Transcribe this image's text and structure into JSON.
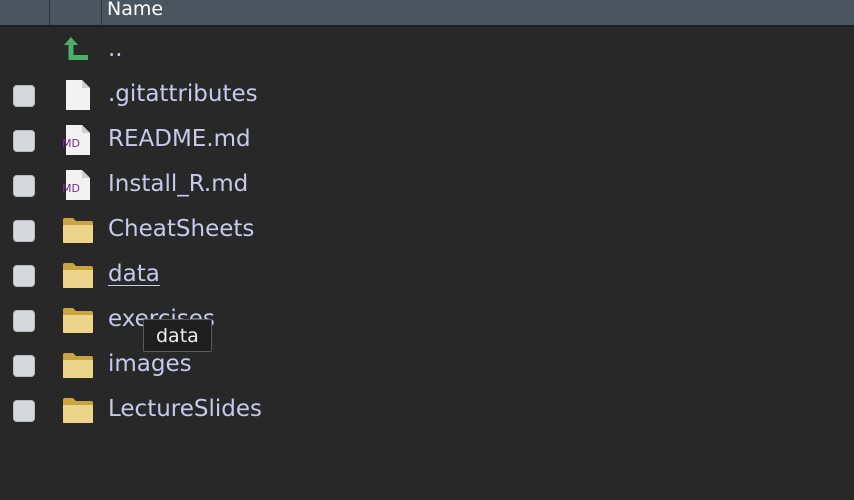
{
  "header": {
    "name_col": "Name"
  },
  "parent": {
    "label": ".."
  },
  "files": [
    {
      "name": ".gitattributes",
      "type": "file"
    },
    {
      "name": "README.md",
      "type": "markdown"
    },
    {
      "name": "Install_R.md",
      "type": "markdown"
    },
    {
      "name": "CheatSheets",
      "type": "folder"
    },
    {
      "name": "data",
      "type": "folder"
    },
    {
      "name": "exercises",
      "type": "folder"
    },
    {
      "name": "images",
      "type": "folder"
    },
    {
      "name": "LectureSlides",
      "type": "folder"
    }
  ],
  "icons": {
    "parent": "up-arrow-icon",
    "file": "file-icon",
    "markdown": "markdown-file-icon",
    "folder": "folder-icon",
    "md_badge": "MD"
  },
  "tooltip": {
    "text": "data"
  },
  "colors": {
    "background": "#282828",
    "header": "#4b5560",
    "text": "#c8c9ec",
    "folder": "#e6c873",
    "arrow": "#4cae68",
    "md_badge": "#7a2a8c"
  }
}
